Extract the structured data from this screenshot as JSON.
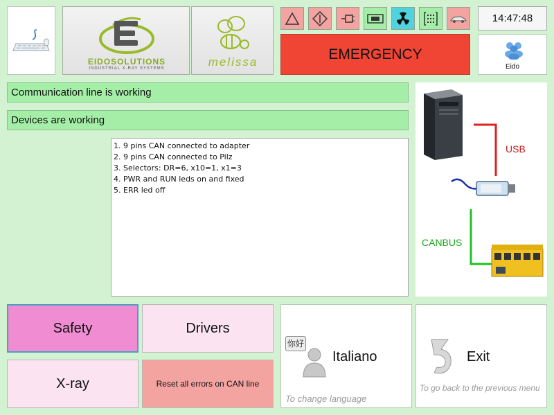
{
  "header": {
    "logo_brand": "EIDOSOLUTIONS",
    "logo_tagline": "INDUSTRIAL X-RAY SYSTEMS",
    "app_logo_text": "melissa",
    "clock": "14:47:48",
    "emergency_label": "EMERGENCY",
    "user_label": "Eido",
    "toolbar_icons": [
      "warning-triangle-icon",
      "diamond-arrow-icon",
      "connector-icon",
      "board-icon",
      "radiation-icon",
      "bracket-grid-icon",
      "car-icon"
    ]
  },
  "status": {
    "communication": "Communication line is working",
    "devices": "Devices are working"
  },
  "checklist": [
    "1. 9 pins CAN connected to adapter",
    "2. 9 pins CAN connected to Pilz",
    "3. Selectors: DR=6, x10=1, x1=3",
    "4. PWR and RUN leds on and fixed",
    "5. ERR led off"
  ],
  "diagram": {
    "usb_label": "USB",
    "canbus_label": "CANBUS",
    "usb_color": "#e02020",
    "canbus_color": "#1ec21e"
  },
  "nav": {
    "safety": "Safety",
    "drivers": "Drivers",
    "xray": "X-ray",
    "reset": "Reset all errors on CAN line",
    "language": "Italiano",
    "language_hint": "To change language",
    "language_badge": "你好",
    "exit": "Exit",
    "exit_hint": "To go back to the previous menu"
  },
  "colors": {
    "background": "#d3f2d1",
    "emergency": "#f04535",
    "status_bar": "#a4eea7",
    "selected": "#f08cd2",
    "unselected": "#fbe3f1",
    "reset": "#f3a3a0"
  }
}
